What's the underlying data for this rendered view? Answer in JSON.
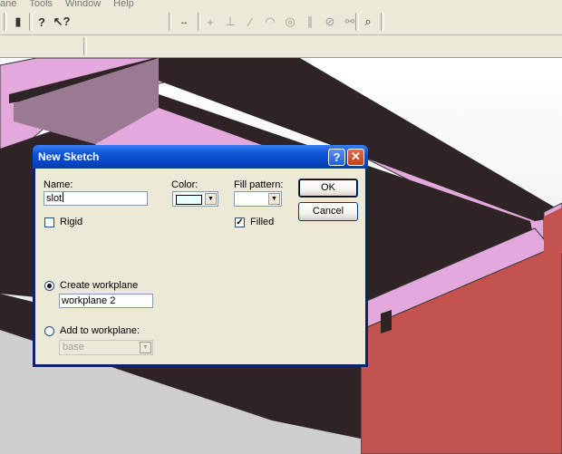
{
  "menu": {
    "items": [
      "ane",
      "Tools",
      "Window",
      "Help"
    ]
  },
  "dialog": {
    "title": "New Sketch",
    "name_label": "Name:",
    "name_value": "slot",
    "color_label": "Color:",
    "color_value": "#e6ffff",
    "fill_pattern_label": "Fill pattern:",
    "fill_pattern_value": "",
    "rigid_label": "Rigid",
    "rigid_checked": false,
    "filled_label": "Filled",
    "filled_checked": true,
    "create_workplane_label": "Create workplane",
    "create_workplane_selected": true,
    "workplane_value": "workplane 2",
    "add_to_workplane_label": "Add to workplane:",
    "add_to_workplane_selected": false,
    "add_to_workplane_value": "base",
    "ok_label": "OK",
    "cancel_label": "Cancel"
  },
  "colors": {
    "accent_titlebar": "#0646c6",
    "face_pink": "#e3a8dc",
    "face_red": "#c4524f",
    "face_dark": "#2e2426"
  }
}
